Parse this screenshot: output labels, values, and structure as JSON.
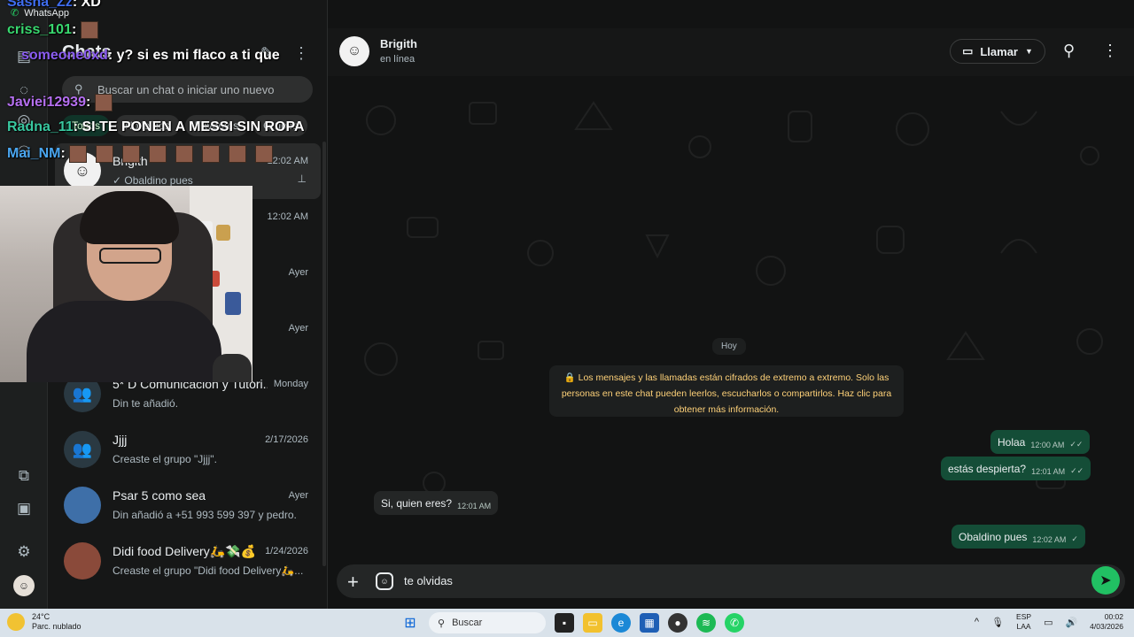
{
  "window": {
    "title": "WhatsApp",
    "controls": [
      "–",
      "▢",
      "✕"
    ]
  },
  "sidebar": {
    "title": "Chats",
    "search_placeholder": "Buscar un chat o iniciar uno nuevo",
    "filters": [
      "Todos",
      "No leídos",
      "Favoritos",
      "Grupos"
    ]
  },
  "chats": [
    {
      "name": "Brigith",
      "preview": "Obaldino pues",
      "time": "12:02 AM",
      "pinned": true,
      "group": false
    },
    {
      "name": "",
      "preview": "",
      "time": "12:02 AM",
      "group": false
    },
    {
      "name": "",
      "preview": "",
      "time": "Ayer",
      "group": false
    },
    {
      "name": "",
      "preview": "",
      "time": "Ayer",
      "group": false
    },
    {
      "name": "5* D Comunicación y Tutori...",
      "preview": "Din te añadió.",
      "time": "Monday",
      "group": true
    },
    {
      "name": "Jjjj",
      "preview": "Creaste el grupo \"Jjjj\".",
      "time": "2/17/2026",
      "group": true
    },
    {
      "name": "Psar 5 como sea",
      "preview": "Din añadió a +51 993 599 397 y pedro.",
      "time": "Ayer",
      "group": false
    },
    {
      "name": "Didi food Delivery🛵💸💰",
      "preview": "Creaste el grupo \"Didi food Delivery🛵...",
      "time": "1/24/2026",
      "group": false
    }
  ],
  "conversation": {
    "contact_name": "Brigith",
    "contact_status": "en línea",
    "call_label": "Llamar",
    "day_label": "Hoy",
    "encryption_notice": "🔒 Los mensajes y las llamadas están cifrados de extremo a extremo. Solo las personas en este chat pueden leerlos, escucharlos o compartirlos. Haz clic para obtener más información.",
    "messages": [
      {
        "text": "Holaa",
        "time": "12:00 AM",
        "dir": "out"
      },
      {
        "text": "estás despierta?",
        "time": "12:01 AM",
        "dir": "out"
      },
      {
        "text": "Si, quien eres?",
        "time": "12:01 AM",
        "dir": "in"
      },
      {
        "text": "Obaldino pues",
        "time": "12:02 AM",
        "dir": "out"
      }
    ],
    "composer_text": "te olvidas"
  },
  "stream_overlay": {
    "app_label": "WhatsApp",
    "lines": [
      {
        "user": "Sasha_Zz",
        "msg": ": XD"
      },
      {
        "user": "criss_101",
        "msg": ":"
      },
      {
        "user": "someone0xd",
        "msg": ": y? si es mi flaco a ti que"
      },
      {
        "user": "Javiei12939",
        "msg": ":"
      },
      {
        "user": "Radna_11",
        "msg": ": SI TE PONEN A MESSI SIN ROPA"
      },
      {
        "user": "Mai_NM",
        "msg": ":"
      }
    ]
  },
  "taskbar": {
    "temperature": "24°C",
    "weather": "Parc. nublado",
    "search_label": "Buscar",
    "lang_top": "ESP",
    "lang_bottom": "LAA",
    "time": "00:02",
    "date": "4/03/2026"
  }
}
